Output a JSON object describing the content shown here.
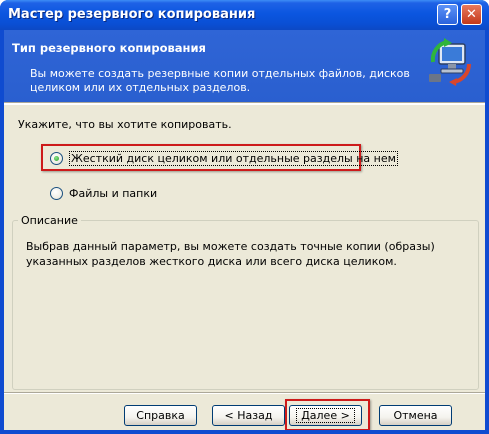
{
  "window": {
    "title": "Мастер резервного копирования",
    "help_button": "?",
    "close_button": "✕"
  },
  "header": {
    "title": "Тип резервного копирования",
    "description": "Вы можете создать резервные копии отдельных файлов, дисков целиком или их отдельных разделов.",
    "icon": "backup-computer-icon"
  },
  "prompt": "Укажите, что вы хотите копировать.",
  "options": [
    {
      "label": "Жесткий диск целиком или отдельные разделы на нем",
      "checked": true
    },
    {
      "label": "Файлы и папки",
      "checked": false
    }
  ],
  "description_group": {
    "title": "Описание",
    "text": "Выбрав данный параметр, вы можете создать точные копии (образы) указанных разделов жесткого диска или всего диска целиком."
  },
  "buttons": {
    "help": "Справка",
    "back": "< Назад",
    "next": "Далее >",
    "cancel": "Отмена"
  },
  "colors": {
    "titlebar": "#0b56e0",
    "header": "#2f65d6",
    "dialog_bg": "#ece9d8",
    "highlight": "#cd1a1a"
  }
}
